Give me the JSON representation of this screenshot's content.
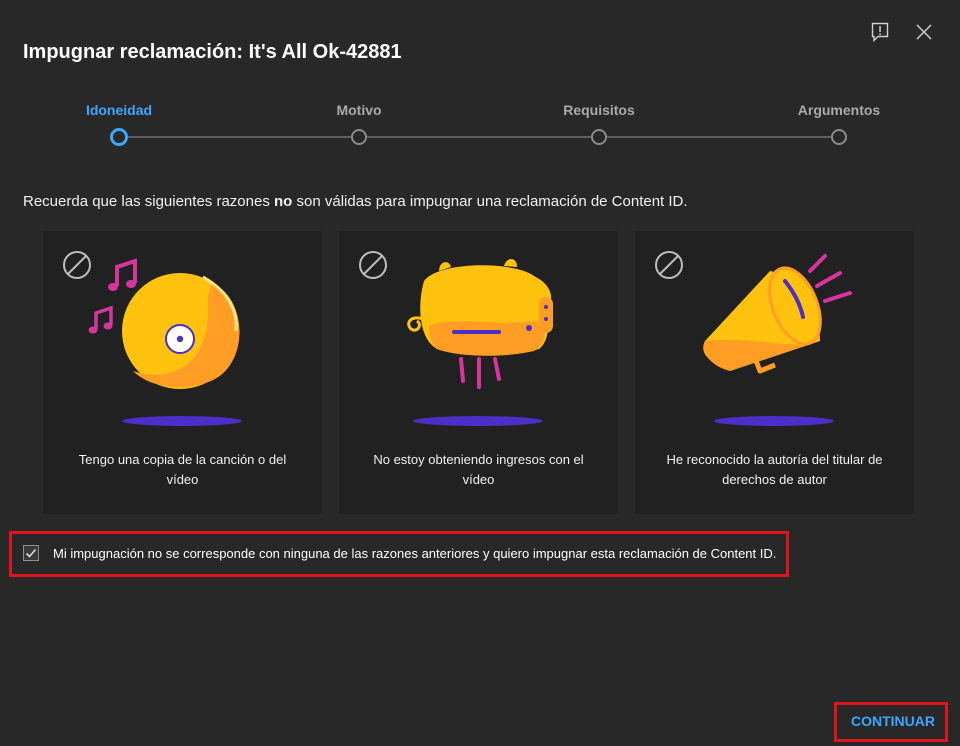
{
  "dialog": {
    "title": "Impugnar reclamación: It's All Ok-42881"
  },
  "steps": [
    {
      "label": "Idoneidad",
      "active": true
    },
    {
      "label": "Motivo",
      "active": false
    },
    {
      "label": "Requisitos",
      "active": false
    },
    {
      "label": "Argumentos",
      "active": false
    }
  ],
  "reminder": {
    "before": "Recuerda que las siguientes razones ",
    "bold": "no",
    "after": " son válidas para impugnar una reclamación de Content ID."
  },
  "cards": [
    {
      "text": "Tengo una copia de la canción o del vídeo",
      "icon": "music-disc-illustration"
    },
    {
      "text": "No estoy obteniendo ingresos con el vídeo",
      "icon": "piggy-bank-illustration"
    },
    {
      "text": "He reconocido la autoría del titular de derechos de autor",
      "icon": "megaphone-illustration"
    }
  ],
  "confirm": {
    "label": "Mi impugnación no se corresponde con ninguna de las razones anteriores y quiero impugnar esta reclamación de Content ID.",
    "checked": true
  },
  "continue_label": "CONTINUAR",
  "colors": {
    "accent": "#3ea6ff",
    "highlight": "#e0141e",
    "background": "#282828",
    "card": "#212121"
  }
}
